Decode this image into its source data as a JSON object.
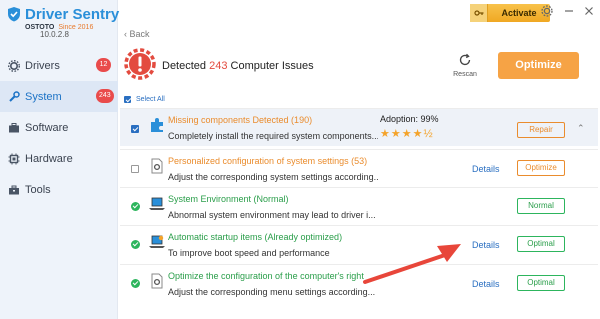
{
  "app": {
    "name": "Driver Sentry",
    "vendor": "OSTOTO",
    "since": "Since 2016",
    "version": "10.0.2.8"
  },
  "sidebar": {
    "items": [
      {
        "label": "Drivers",
        "icon": "gear-icon",
        "badge": "12",
        "active": false
      },
      {
        "label": "System",
        "icon": "wrench-icon",
        "badge": "243",
        "active": true
      },
      {
        "label": "Software",
        "icon": "briefcase-icon",
        "badge": "",
        "active": false
      },
      {
        "label": "Hardware",
        "icon": "chip-icon",
        "badge": "",
        "active": false
      },
      {
        "label": "Tools",
        "icon": "toolbox-icon",
        "badge": "",
        "active": false
      }
    ]
  },
  "topbar": {
    "activate_label": "Activate",
    "icons": [
      "settings-icon",
      "minimize-icon",
      "close-icon"
    ]
  },
  "main": {
    "back_label": "Back",
    "summary": {
      "prefix": "Detected",
      "count": "243",
      "suffix": "Computer Issues"
    },
    "rescan_label": "Rescan",
    "optimize_label": "Optimize",
    "select_all_label": "Select All"
  },
  "issues": [
    {
      "title": "Missing components Detected (190)",
      "desc": "Completely install the required system components...",
      "adoption": "Adoption: 99%",
      "stars": "★★★★½",
      "details": "",
      "action": "Repair",
      "style": "orange",
      "state": "checked"
    },
    {
      "title": "Personalized configuration of system settings (53)",
      "desc": "Adjust the corresponding system settings according...",
      "details": "Details",
      "action": "Optimize",
      "style": "orange",
      "state": "unchecked"
    },
    {
      "title": "System Environment (Normal)",
      "desc": "Abnormal system environment may lead to driver i...",
      "details": "",
      "action": "Normal",
      "style": "green",
      "state": "ok"
    },
    {
      "title": "Automatic startup items (Already optimized)",
      "desc": "To improve boot speed and performance",
      "details": "Details",
      "action": "Optimal",
      "style": "green",
      "state": "ok"
    },
    {
      "title": "Optimize the configuration of the computer's right",
      "desc": "Adjust the corresponding menu settings according...",
      "details": "Details",
      "action": "Optimal",
      "style": "green",
      "state": "ok"
    }
  ],
  "colors": {
    "brand": "#2a8fd9",
    "accent_orange": "#f6a345",
    "alert_red": "#e34b3f",
    "ok_green": "#2db55d",
    "annotation_arrow": "#e8463a"
  }
}
